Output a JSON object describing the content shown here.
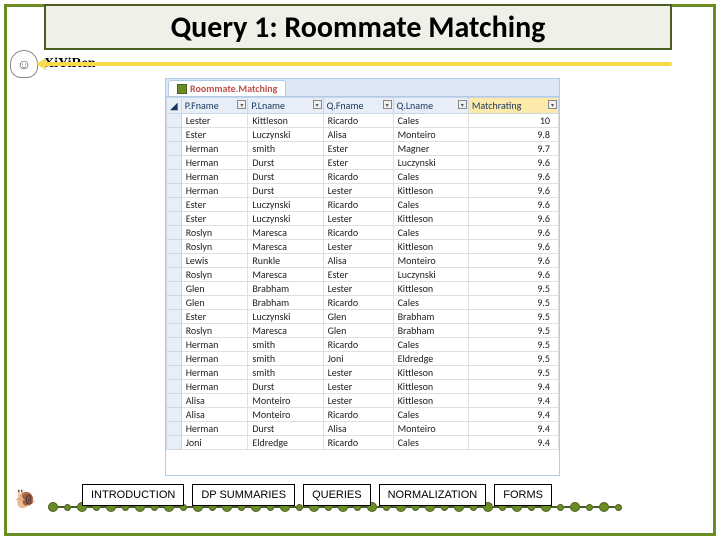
{
  "title": "Query 1: Roommate Matching",
  "brand": "XiYiRen",
  "tab": {
    "label": "Roommate.Matching"
  },
  "columns": [
    "P.Fname",
    "P.Lname",
    "Q.Fname",
    "Q.Lname",
    "Matchrating"
  ],
  "rows": [
    [
      "Lester",
      "Kittleson",
      "Ricardo",
      "Cales",
      "10"
    ],
    [
      "Ester",
      "Luczynski",
      "Alisa",
      "Monteiro",
      "9.8"
    ],
    [
      "Herman",
      "smith",
      "Ester",
      "Magner",
      "9.7"
    ],
    [
      "Herman",
      "Durst",
      "Ester",
      "Luczynski",
      "9.6"
    ],
    [
      "Herman",
      "Durst",
      "Ricardo",
      "Cales",
      "9.6"
    ],
    [
      "Herman",
      "Durst",
      "Lester",
      "Kittleson",
      "9.6"
    ],
    [
      "Ester",
      "Luczynski",
      "Ricardo",
      "Cales",
      "9.6"
    ],
    [
      "Ester",
      "Luczynski",
      "Lester",
      "Kittleson",
      "9.6"
    ],
    [
      "Roslyn",
      "Maresca",
      "Ricardo",
      "Cales",
      "9.6"
    ],
    [
      "Roslyn",
      "Maresca",
      "Lester",
      "Kittleson",
      "9.6"
    ],
    [
      "Lewis",
      "Runkle",
      "Alisa",
      "Monteiro",
      "9.6"
    ],
    [
      "Roslyn",
      "Maresca",
      "Ester",
      "Luczynski",
      "9.6"
    ],
    [
      "Glen",
      "Brabham",
      "Lester",
      "Kittleson",
      "9.5"
    ],
    [
      "Glen",
      "Brabham",
      "Ricardo",
      "Cales",
      "9.5"
    ],
    [
      "Ester",
      "Luczynski",
      "Glen",
      "Brabham",
      "9.5"
    ],
    [
      "Roslyn",
      "Maresca",
      "Glen",
      "Brabham",
      "9.5"
    ],
    [
      "Herman",
      "smith",
      "Ricardo",
      "Cales",
      "9.5"
    ],
    [
      "Herman",
      "smith",
      "Joni",
      "Eldredge",
      "9.5"
    ],
    [
      "Herman",
      "smith",
      "Lester",
      "Kittleson",
      "9.5"
    ],
    [
      "Herman",
      "Durst",
      "Lester",
      "Kittleson",
      "9.4"
    ],
    [
      "Alisa",
      "Monteiro",
      "Lester",
      "Kittleson",
      "9.4"
    ],
    [
      "Alisa",
      "Monteiro",
      "Ricardo",
      "Cales",
      "9.4"
    ],
    [
      "Herman",
      "Durst",
      "Alisa",
      "Monteiro",
      "9.4"
    ],
    [
      "Joni",
      "Eldredge",
      "Ricardo",
      "Cales",
      "9.4"
    ]
  ],
  "nav": {
    "introduction": "INTRODUCTION",
    "dp": "DP SUMMARIES",
    "queries": "QUERIES",
    "normalization": "NORMALIZATION",
    "forms": "FORMS"
  }
}
